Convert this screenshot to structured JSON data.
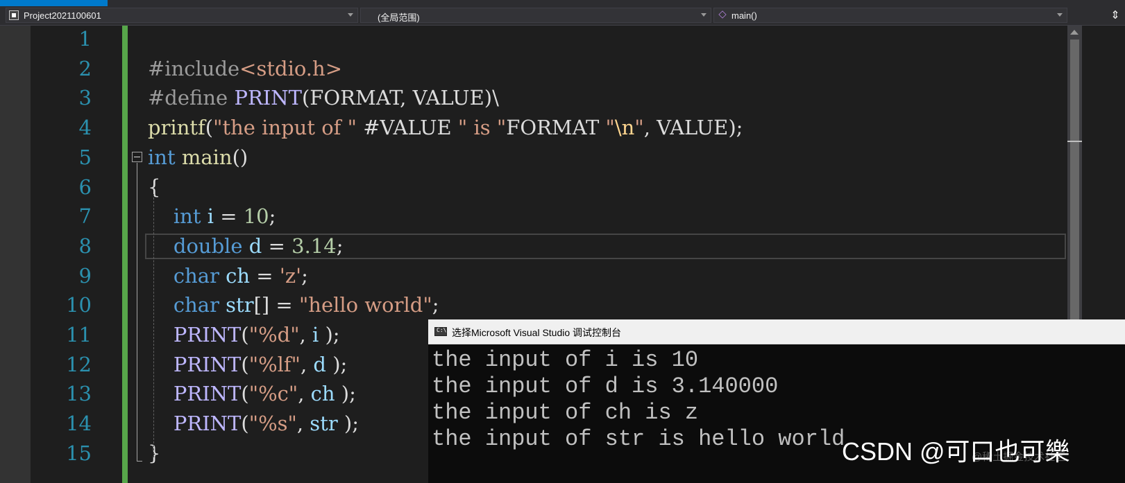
{
  "navbar": {
    "project": "Project2021100601",
    "scope": "(全局范围)",
    "function": "main()"
  },
  "editor": {
    "line_numbers": [
      "1",
      "2",
      "3",
      "4",
      "5",
      "6",
      "7",
      "8",
      "9",
      "10",
      "11",
      "12",
      "13",
      "14",
      "15"
    ],
    "lines": [
      [],
      [
        {
          "t": "#include",
          "c": "pp"
        },
        {
          "t": "<stdio.h>",
          "c": "str"
        }
      ],
      [
        {
          "t": "#define ",
          "c": "pp"
        },
        {
          "t": "PRINT",
          "c": "mac"
        },
        {
          "t": "(FORMAT, VALUE)\\",
          "c": "pl"
        }
      ],
      [
        {
          "t": "printf",
          "c": "fn"
        },
        {
          "t": "(",
          "c": "pl"
        },
        {
          "t": "\"the input of \"",
          "c": "str"
        },
        {
          "t": " #VALUE ",
          "c": "pl"
        },
        {
          "t": "\" is \"",
          "c": "str"
        },
        {
          "t": "FORMAT ",
          "c": "pl"
        },
        {
          "t": "\"",
          "c": "str"
        },
        {
          "t": "\\n",
          "c": "esc"
        },
        {
          "t": "\"",
          "c": "str"
        },
        {
          "t": ", VALUE);",
          "c": "pl"
        }
      ],
      [
        {
          "t": "int",
          "c": "kw"
        },
        {
          "t": " main",
          "c": "fn"
        },
        {
          "t": "()",
          "c": "pl"
        }
      ],
      [
        {
          "t": "{",
          "c": "pl"
        }
      ],
      [
        {
          "t": "    ",
          "c": "pl"
        },
        {
          "t": "int",
          "c": "kw"
        },
        {
          "t": " i",
          "c": "var"
        },
        {
          "t": " = ",
          "c": "pl"
        },
        {
          "t": "10",
          "c": "num"
        },
        {
          "t": ";",
          "c": "pl"
        }
      ],
      [
        {
          "t": "    ",
          "c": "pl"
        },
        {
          "t": "double",
          "c": "kw"
        },
        {
          "t": " d",
          "c": "var"
        },
        {
          "t": " = ",
          "c": "pl"
        },
        {
          "t": "3.14",
          "c": "num"
        },
        {
          "t": ";",
          "c": "pl"
        }
      ],
      [
        {
          "t": "    ",
          "c": "pl"
        },
        {
          "t": "char",
          "c": "kw"
        },
        {
          "t": " ch",
          "c": "var"
        },
        {
          "t": " = ",
          "c": "pl"
        },
        {
          "t": "'z'",
          "c": "str"
        },
        {
          "t": ";",
          "c": "pl"
        }
      ],
      [
        {
          "t": "    ",
          "c": "pl"
        },
        {
          "t": "char",
          "c": "kw"
        },
        {
          "t": " str",
          "c": "var"
        },
        {
          "t": "[] = ",
          "c": "pl"
        },
        {
          "t": "\"hello world\"",
          "c": "str"
        },
        {
          "t": ";",
          "c": "pl"
        }
      ],
      [
        {
          "t": "    ",
          "c": "pl"
        },
        {
          "t": "PRINT",
          "c": "mac"
        },
        {
          "t": "(",
          "c": "pl"
        },
        {
          "t": "\"%d\"",
          "c": "str"
        },
        {
          "t": ", ",
          "c": "pl"
        },
        {
          "t": "i",
          "c": "var"
        },
        {
          "t": " );",
          "c": "pl"
        }
      ],
      [
        {
          "t": "    ",
          "c": "pl"
        },
        {
          "t": "PRINT",
          "c": "mac"
        },
        {
          "t": "(",
          "c": "pl"
        },
        {
          "t": "\"%lf\"",
          "c": "str"
        },
        {
          "t": ", ",
          "c": "pl"
        },
        {
          "t": "d",
          "c": "var"
        },
        {
          "t": " );",
          "c": "pl"
        }
      ],
      [
        {
          "t": "    ",
          "c": "pl"
        },
        {
          "t": "PRINT",
          "c": "mac"
        },
        {
          "t": "(",
          "c": "pl"
        },
        {
          "t": "\"%c\"",
          "c": "str"
        },
        {
          "t": ", ",
          "c": "pl"
        },
        {
          "t": "ch",
          "c": "var"
        },
        {
          "t": " );",
          "c": "pl"
        }
      ],
      [
        {
          "t": "    ",
          "c": "pl"
        },
        {
          "t": "PRINT",
          "c": "mac"
        },
        {
          "t": "(",
          "c": "pl"
        },
        {
          "t": "\"%s\"",
          "c": "str"
        },
        {
          "t": ", ",
          "c": "pl"
        },
        {
          "t": "str",
          "c": "var"
        },
        {
          "t": " );",
          "c": "pl"
        }
      ],
      [
        {
          "t": "}",
          "c": "pl"
        }
      ]
    ]
  },
  "console": {
    "title": "选择Microsoft Visual Studio 调试控制台",
    "output": [
      "the input of i is 10",
      "the input of d is 3.140000",
      "the input of ch is z",
      "the input of str is hello world"
    ]
  },
  "watermark": {
    "text": "CSDN @可口也可樂",
    "faint": "@稀土掘金技术社区"
  },
  "colors": {
    "keyword": "#569cd6",
    "macro": "#beb7ff",
    "string": "#d69d85",
    "number": "#b5cea8",
    "line_number": "#2b91af",
    "change_bar": "#57a64a"
  }
}
